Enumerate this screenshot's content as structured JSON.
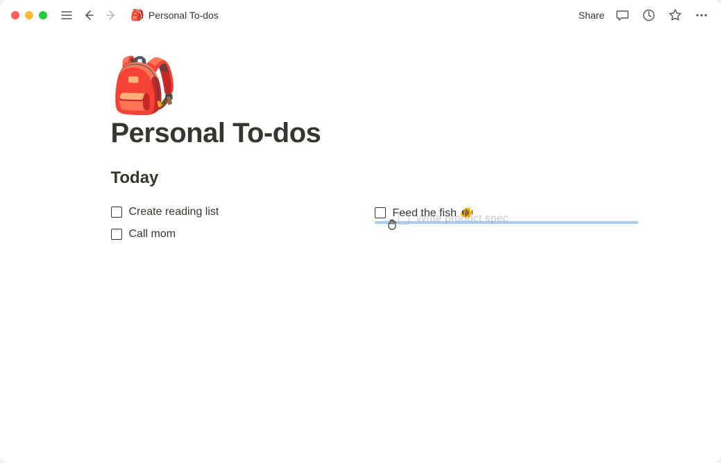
{
  "window": {
    "breadcrumb_emoji": "🎒",
    "breadcrumb_title": "Personal To-dos"
  },
  "toolbar": {
    "share_label": "Share"
  },
  "page": {
    "icon": "🎒",
    "title": "Personal To-dos"
  },
  "sections": {
    "today_heading": "Today"
  },
  "todos": {
    "col1": [
      {
        "text": "Create reading list"
      },
      {
        "text": "Call mom"
      }
    ],
    "col2": [
      {
        "text": "Feed the fish 🐠"
      }
    ],
    "dragging": {
      "text": "Write product spec"
    }
  }
}
